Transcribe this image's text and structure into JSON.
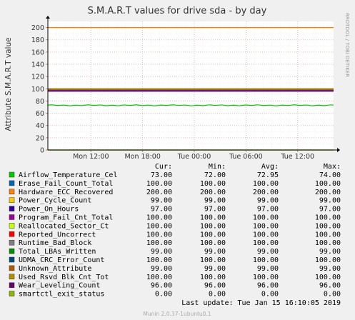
{
  "chart_data": {
    "type": "line",
    "title": "S.M.A.R.T values for drive sda - by day",
    "ylabel": "Attribute S.M.A.R.T value",
    "ylim": [
      0,
      210
    ],
    "yticks": [
      0,
      20,
      40,
      60,
      80,
      100,
      120,
      140,
      160,
      180,
      200
    ],
    "ytick_labels": [
      "0",
      "20",
      "40",
      "60",
      "80",
      "100",
      "120",
      "140",
      "160",
      "180",
      "200"
    ],
    "xlim": [
      "2019-01-14 07:00",
      "2019-01-15 16:10"
    ],
    "xticks": [
      "2019-01-14 12:00",
      "2019-01-14 18:00",
      "2019-01-15 00:00",
      "2019-01-15 06:00",
      "2019-01-15 12:00"
    ],
    "xtick_labels": [
      "Mon 12:00",
      "Mon 18:00",
      "Tue 00:00",
      "Tue 06:00",
      "Tue 12:00"
    ],
    "grid": true,
    "legend_position": "bottom",
    "stat_headers": [
      "Cur:",
      "Min:",
      "Avg:",
      "Max:"
    ],
    "series": [
      {
        "name": "Airflow_Temperature_Cel",
        "color": "#00cc00",
        "cur": "73.00",
        "min": "72.00",
        "avg": "72.95",
        "max": "74.00",
        "level": 73
      },
      {
        "name": "Erase_Fail_Count_Total",
        "color": "#0066b3",
        "cur": "100.00",
        "min": "100.00",
        "avg": "100.00",
        "max": "100.00",
        "level": 100
      },
      {
        "name": "Hardware_ECC_Recovered",
        "color": "#ff8000",
        "cur": "200.00",
        "min": "200.00",
        "avg": "200.00",
        "max": "200.00",
        "level": 200
      },
      {
        "name": "Power_Cycle_Count",
        "color": "#ffcc00",
        "cur": "99.00",
        "min": "99.00",
        "avg": "99.00",
        "max": "99.00",
        "level": 99
      },
      {
        "name": "Power_On_Hours",
        "color": "#330099",
        "cur": "97.00",
        "min": "97.00",
        "avg": "97.00",
        "max": "97.00",
        "level": 97
      },
      {
        "name": "Program_Fail_Cnt_Total",
        "color": "#990099",
        "cur": "100.00",
        "min": "100.00",
        "avg": "100.00",
        "max": "100.00",
        "level": 100
      },
      {
        "name": "Reallocated_Sector_Ct",
        "color": "#ccff00",
        "cur": "100.00",
        "min": "100.00",
        "avg": "100.00",
        "max": "100.00",
        "level": 100
      },
      {
        "name": "Reported_Uncorrect",
        "color": "#ff0000",
        "cur": "100.00",
        "min": "100.00",
        "avg": "100.00",
        "max": "100.00",
        "level": 100
      },
      {
        "name": "Runtime_Bad_Block",
        "color": "#808080",
        "cur": "100.00",
        "min": "100.00",
        "avg": "100.00",
        "max": "100.00",
        "level": 100
      },
      {
        "name": "Total_LBAs_Written",
        "color": "#008f00",
        "cur": "99.00",
        "min": "99.00",
        "avg": "99.00",
        "max": "99.00",
        "level": 99
      },
      {
        "name": "UDMA_CRC_Error_Count",
        "color": "#00487d",
        "cur": "100.00",
        "min": "100.00",
        "avg": "100.00",
        "max": "100.00",
        "level": 100
      },
      {
        "name": "Unknown_Attribute",
        "color": "#b35a00",
        "cur": "99.00",
        "min": "99.00",
        "avg": "99.00",
        "max": "99.00",
        "level": 99
      },
      {
        "name": "Used_Rsvd_Blk_Cnt_Tot",
        "color": "#b38f00",
        "cur": "100.00",
        "min": "100.00",
        "avg": "100.00",
        "max": "100.00",
        "level": 100
      },
      {
        "name": "Wear_Leveling_Count",
        "color": "#6b006b",
        "cur": "96.00",
        "min": "96.00",
        "avg": "96.00",
        "max": "96.00",
        "level": 96
      },
      {
        "name": "smartctl_exit_status",
        "color": "#8fb300",
        "cur": "0.00",
        "min": "0.00",
        "avg": "0.00",
        "max": "0.00",
        "level": 0
      }
    ]
  },
  "last_update": "Last update: Tue Jan 15 16:10:05 2019",
  "side_label": "RRDTOOL / TOBI OETIKER",
  "footer": "Munin 2.0.37-1ubuntu0.1"
}
